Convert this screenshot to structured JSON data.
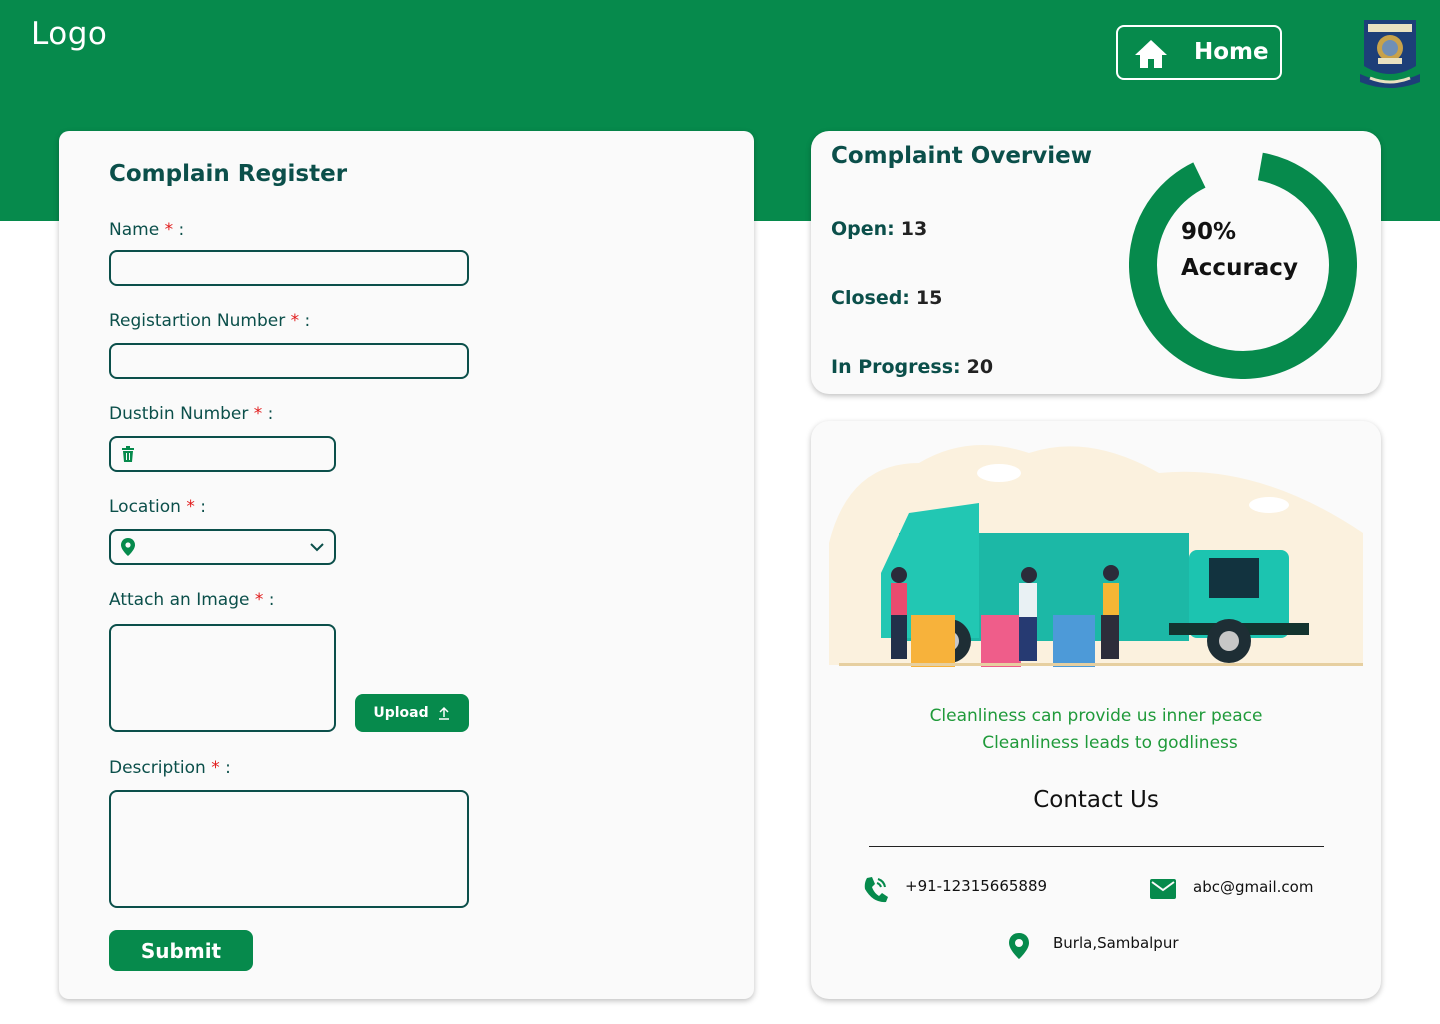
{
  "header": {
    "logo_text": "Logo",
    "home_label": "Home",
    "home_icon": "home-icon",
    "emblem_icon": "university-emblem",
    "brand_color": "#068a4c"
  },
  "form": {
    "title": "Complain Register",
    "required_mark": "*",
    "fields": {
      "name": {
        "label": "Name",
        "suffix": " :",
        "value": "",
        "placeholder": ""
      },
      "registration": {
        "label": "Registartion Number",
        "suffix": " :",
        "value": "",
        "placeholder": ""
      },
      "dustbin": {
        "label": "Dustbin  Number",
        "suffix": " :",
        "value": "",
        "placeholder": "",
        "icon": "trash-icon"
      },
      "location": {
        "label": "Location",
        "suffix": " :",
        "value": "",
        "icon": "map-pin-icon"
      },
      "image": {
        "label": "Attach an Image",
        "suffix": " :"
      },
      "description": {
        "label": "Description",
        "suffix": " :",
        "value": "",
        "placeholder": ""
      }
    },
    "upload_label": "Upload",
    "submit_label": "Submit"
  },
  "overview": {
    "title": "Complaint Overview",
    "stats": [
      {
        "label": "Open:",
        "value": "13"
      },
      {
        "label": "Closed:",
        "value": "15"
      },
      {
        "label": "In Progress:",
        "value": "20"
      }
    ],
    "accuracy_value": "90%",
    "accuracy_label": "Accuracy",
    "accuracy_fraction": 0.9
  },
  "info": {
    "quote_line1": "Cleanliness can provide us inner peace",
    "quote_line2": "Cleanliness leads to godliness",
    "contact_title": "Contact Us",
    "phone": "+91-12315665889",
    "email": "abc@gmail.com",
    "address": "Burla,Sambalpur",
    "accent_color": "#1f9a3a"
  }
}
